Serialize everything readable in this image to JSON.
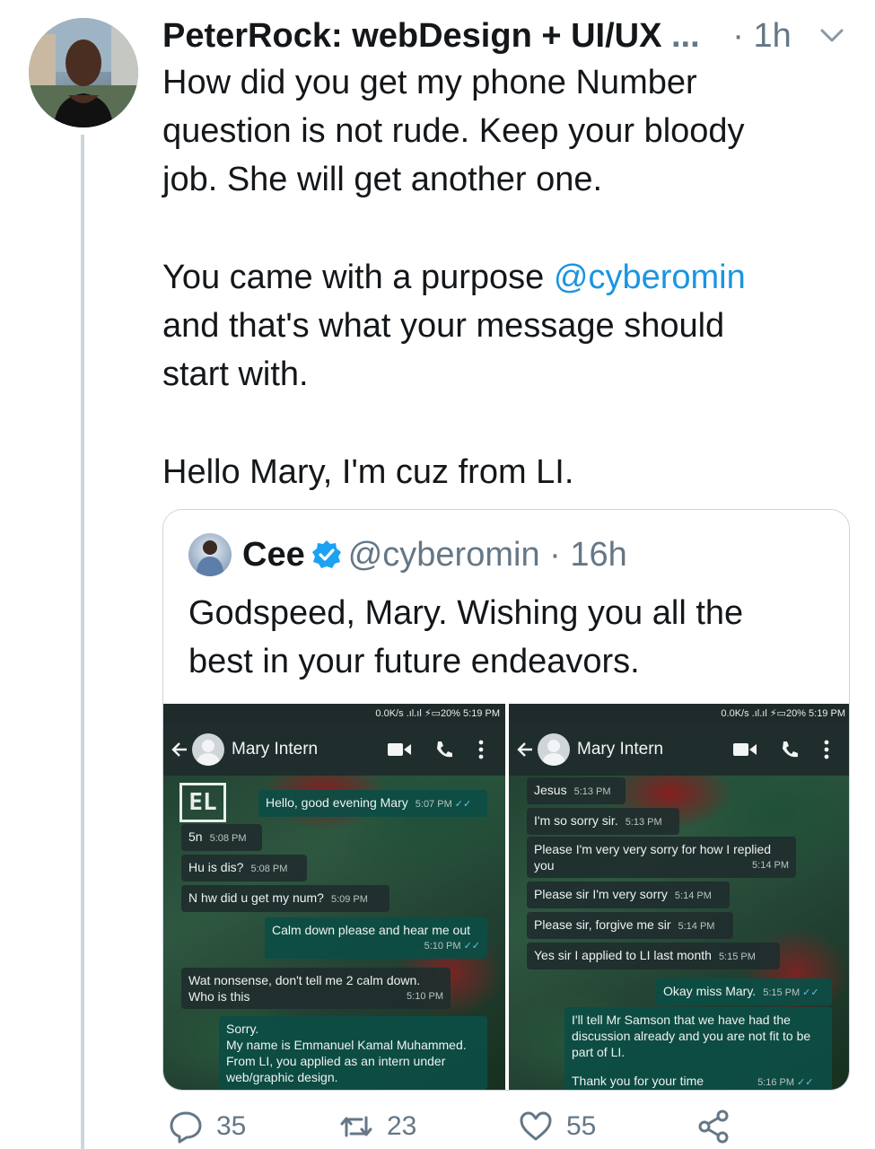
{
  "tweet": {
    "author": "PeterRock: webDesign + UI/UX",
    "truncation": "...",
    "separator": "·",
    "time": "1h",
    "lines": [
      "How did you get my phone Number",
      "question is not rude. Keep your bloody",
      "job. She will get another one."
    ],
    "p2_line1_prefix": "You came with a purpose ",
    "p2_mention": "@cyberomin",
    "p2_lines_rest": [
      "and that's what your message should",
      "start with."
    ],
    "p3": "Hello Mary, I'm cuz from LI."
  },
  "quoted": {
    "name": "Cee",
    "handle": "@cyberomin",
    "separator": "·",
    "time": "16h",
    "lines": [
      "Godspeed, Mary. Wishing you all the",
      "best in your future endeavors."
    ]
  },
  "screenshot_left": {
    "status": "0.0K/s .ıl.ıl ⚡▭20% 5:19 PM",
    "contact": "Mary Intern",
    "messages": [
      {
        "dir": "out",
        "text": "Hello, good evening Mary",
        "time": "5:07 PM"
      },
      {
        "dir": "in",
        "text": "5n",
        "time": "5:08 PM"
      },
      {
        "dir": "in",
        "text": "Hu is dis?",
        "time": "5:08 PM"
      },
      {
        "dir": "in",
        "text": "N hw did u get my num?",
        "time": "5:09 PM"
      },
      {
        "dir": "out",
        "text": "Calm down please and hear me out",
        "time": "5:10 PM"
      },
      {
        "dir": "in",
        "text": "Wat nonsense, don't tell me 2 calm down.",
        "text2": "Who is this",
        "time": "5:10 PM"
      },
      {
        "dir": "out",
        "text": "Sorry.",
        "text2": "My name is Emmanuel Kamal Muhammed.",
        "text3": "From LI, you applied as an intern under",
        "text4": "web/graphic design."
      }
    ]
  },
  "screenshot_right": {
    "status": "0.0K/s .ıl.ıl ⚡▭20% 5:19 PM",
    "contact": "Mary Intern",
    "messages": [
      {
        "dir": "in",
        "text": "Jesus",
        "time": "5:13 PM"
      },
      {
        "dir": "in",
        "text": "I'm so sorry sir.",
        "time": "5:13 PM"
      },
      {
        "dir": "in",
        "text": "Please I'm very very sorry for how I replied",
        "text2": "you",
        "time": "5:14 PM"
      },
      {
        "dir": "in",
        "text": "Please sir I'm very sorry",
        "time": "5:14 PM"
      },
      {
        "dir": "in",
        "text": "Please sir, forgive me sir",
        "time": "5:14 PM"
      },
      {
        "dir": "in",
        "text": "Yes sir I applied to LI last month",
        "time": "5:15 PM"
      },
      {
        "dir": "out",
        "text": "Okay miss Mary.",
        "time": "5:15 PM"
      },
      {
        "dir": "out",
        "text": "I'll tell Mr Samson that we have had the",
        "text2": "discussion already and you are not fit to be",
        "text3": "part of LI.",
        "text4": "Thank you for your time",
        "time": "5:16 PM"
      }
    ]
  },
  "actions": {
    "replies": "35",
    "retweets": "23",
    "likes": "55"
  },
  "icons": {
    "menu": "chevron-down-icon",
    "reply": "reply-icon",
    "retweet": "retweet-icon",
    "like": "heart-icon",
    "share": "share-icon",
    "verified": "verified-badge-icon"
  },
  "colors": {
    "link": "#1b95e0",
    "secondary_text": "#657786",
    "verified": "#1da1f2",
    "whatsapp_outgoing": "#0d4d44",
    "whatsapp_read_tick": "#5fc6e8"
  }
}
